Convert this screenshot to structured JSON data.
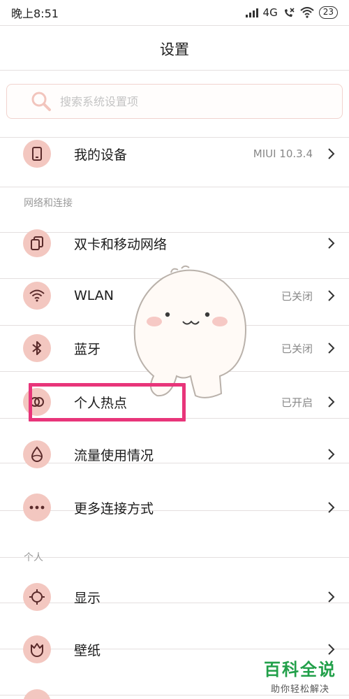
{
  "status": {
    "time": "晚上8:51",
    "network": "4G",
    "battery": "23"
  },
  "title": "设置",
  "search": {
    "placeholder": "搜索系统设置项"
  },
  "device": {
    "label": "我的设备",
    "value": "MIUI 10.3.4",
    "icon": "phone-icon"
  },
  "sections": {
    "network": "网络和连接",
    "personal": "个人"
  },
  "network_items": [
    {
      "label": "双卡和移动网络",
      "value": "",
      "icon": "dual-sim-icon"
    },
    {
      "label": "WLAN",
      "value": "已关闭",
      "icon": "wifi-icon"
    },
    {
      "label": "蓝牙",
      "value": "已关闭",
      "icon": "bluetooth-icon"
    },
    {
      "label": "个人热点",
      "value": "已开启",
      "icon": "hotspot-icon"
    },
    {
      "label": "流量使用情况",
      "value": "",
      "icon": "data-usage-icon"
    },
    {
      "label": "更多连接方式",
      "value": "",
      "icon": "more-icon"
    }
  ],
  "personal_items": [
    {
      "label": "显示",
      "value": "",
      "icon": "display-icon"
    },
    {
      "label": "壁纸",
      "value": "",
      "icon": "wallpaper-icon"
    }
  ],
  "watermark": {
    "title": "百科全说",
    "subtitle": "助你轻松解决"
  },
  "colors": {
    "icon_bg": "#f3c7c0",
    "highlight": "#e8357a",
    "watermark": "#22a04a"
  }
}
